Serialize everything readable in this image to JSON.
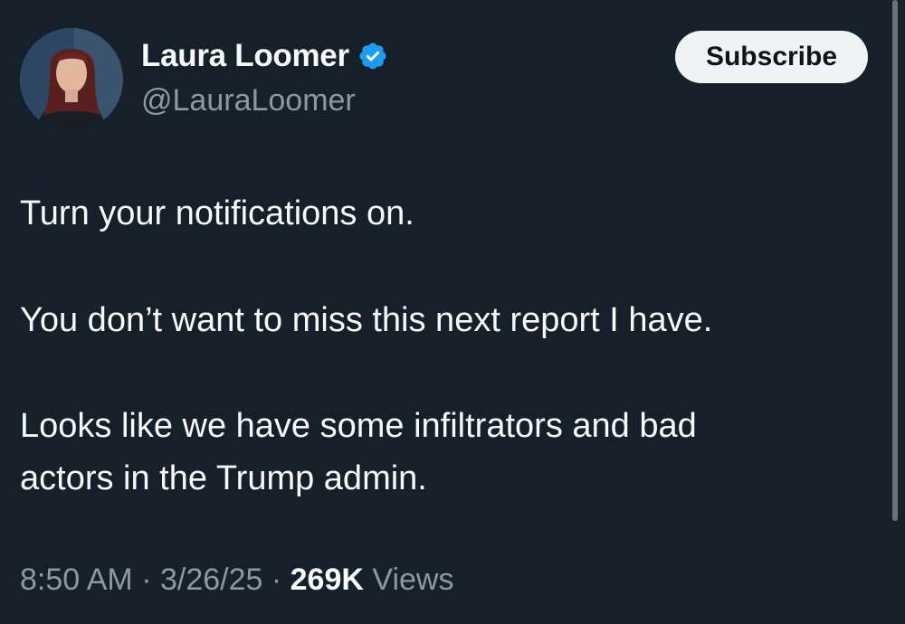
{
  "author": {
    "display_name": "Laura Loomer",
    "handle": "@LauraLoomer",
    "verified_icon": "verified-badge-icon",
    "avatar": "avatar-photo"
  },
  "actions": {
    "subscribe_label": "Subscribe"
  },
  "tweet": {
    "lines": [
      "Turn your notifications on.",
      "You don’t want to miss this next report I have.",
      "Looks like we have some infiltrators and bad",
      "actors in the Trump admin."
    ]
  },
  "meta": {
    "time": "8:50 AM",
    "separator": " · ",
    "date": "3/26/25",
    "views_count": "269K",
    "views_label": "Views"
  },
  "colors": {
    "background": "#15202b",
    "text_primary": "#f7f9f9",
    "text_secondary": "#8b98a5",
    "verified_blue": "#1d9bf0",
    "button_bg": "#eff3f4"
  }
}
